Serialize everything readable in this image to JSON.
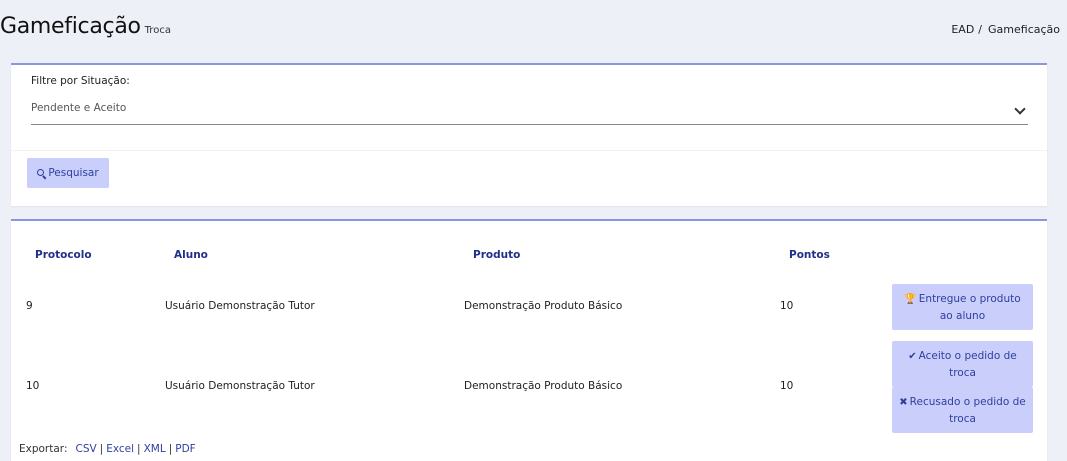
{
  "header": {
    "title": "Gameficação",
    "subtitle": "Troca",
    "breadcrumb": [
      "EAD",
      "Gameficação"
    ]
  },
  "filter": {
    "label": "Filtre por Situação:",
    "selected": "Pendente e Aceito",
    "search_label": "Pesquisar"
  },
  "table": {
    "headers": [
      "Protocolo",
      "Aluno",
      "Produto",
      "Pontos"
    ],
    "rows": [
      {
        "protocolo": "9",
        "aluno": "Usuário Demonstração Tutor",
        "produto": "Demonstração Produto Básico",
        "pontos": "10",
        "actions": [
          {
            "label": "Entregue o produto ao aluno",
            "icon": "trophy-icon"
          }
        ]
      },
      {
        "protocolo": "10",
        "aluno": "Usuário Demonstração Tutor",
        "produto": "Demonstração Produto Básico",
        "pontos": "10",
        "actions": [
          {
            "label": "Aceito o pedido de troca",
            "icon": "check-icon"
          },
          {
            "label": "Recusado o pedido de troca",
            "icon": "times-icon"
          }
        ]
      }
    ]
  },
  "export": {
    "label": "Exportar:",
    "links": [
      "CSV",
      "Excel",
      "XML",
      "PDF"
    ]
  },
  "colors": {
    "accent": "#8b95e3",
    "button_bg": "#c9cffa",
    "button_text": "#2f3fa0",
    "header_text": "#1f2f8a",
    "background": "#eef0f8"
  }
}
